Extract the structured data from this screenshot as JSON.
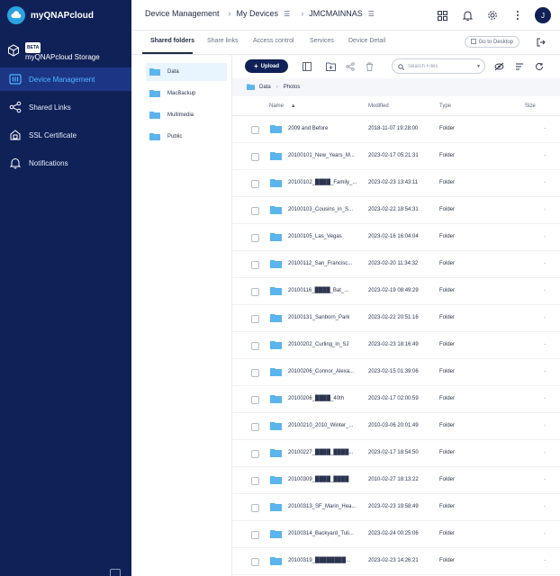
{
  "brand": {
    "name": "myQNAPcloud"
  },
  "sidebar": {
    "storage_badge": "BETA",
    "storage_label": "myQNAPcloud Storage",
    "items": [
      {
        "label": "Device Management",
        "icon": "device-management-icon"
      },
      {
        "label": "Shared Links",
        "icon": "share-icon"
      },
      {
        "label": "SSL Certificate",
        "icon": "ssl-certificate-icon"
      },
      {
        "label": "Notifications",
        "icon": "bell-icon"
      }
    ]
  },
  "header": {
    "breadcrumb": [
      "Device Management",
      "My Devices",
      "JMCMAINNAS"
    ],
    "avatar_initial": "J"
  },
  "tabs": {
    "items": [
      "Shared folders",
      "Share links",
      "Access control",
      "Services",
      "Device Detail"
    ],
    "active": "Shared folders",
    "go_to_desktop": "Go to Desktop"
  },
  "tree": {
    "items": [
      "Data",
      "MacBackup",
      "Multimedia",
      "Public"
    ],
    "selected": "Data"
  },
  "toolbar": {
    "upload_label": "Upload",
    "search_placeholder": "Search Files"
  },
  "path": [
    "Data",
    "Photos"
  ],
  "columns": {
    "name": "Name",
    "modified": "Modified",
    "type": "Type",
    "size": "Size"
  },
  "files": [
    {
      "name": "2009 and Before",
      "modified": "2018-11-07 19:28:00",
      "type": "Folder",
      "size": "-"
    },
    {
      "name": "20100101_New_Years_M...",
      "modified": "2023-02-17 05:21:31",
      "type": "Folder",
      "size": "-"
    },
    {
      "name": "20100102_████_Family_...",
      "modified": "2023-02-23 13:43:11",
      "type": "Folder",
      "size": "-"
    },
    {
      "name": "20100103_Cousins_in_S...",
      "modified": "2023-02-22 18:54:31",
      "type": "Folder",
      "size": "-"
    },
    {
      "name": "20100105_Las_Vegas",
      "modified": "2023-02-16 16:04:04",
      "type": "Folder",
      "size": "-"
    },
    {
      "name": "20100112_San_Francisc...",
      "modified": "2023-02-20 11:34:32",
      "type": "Folder",
      "size": "-"
    },
    {
      "name": "20100116_████_Bat_...",
      "modified": "2023-02-19 08:49:29",
      "type": "Folder",
      "size": "-"
    },
    {
      "name": "20100131_Sanborn_Park",
      "modified": "2023-02-22 20:51:16",
      "type": "Folder",
      "size": "-"
    },
    {
      "name": "20100202_Curling_in_SJ",
      "modified": "2023-02-23 18:16:49",
      "type": "Folder",
      "size": "-"
    },
    {
      "name": "20100206_Connor_Alexa...",
      "modified": "2023-02-15 01:39:06",
      "type": "Folder",
      "size": "-"
    },
    {
      "name": "20100206_████_40th",
      "modified": "2023-02-17 02:00:59",
      "type": "Folder",
      "size": "-"
    },
    {
      "name": "20100210_2010_Winter_...",
      "modified": "2010-03-06 20:01:49",
      "type": "Folder",
      "size": "-"
    },
    {
      "name": "20100227_████_████...",
      "modified": "2023-02-17 18:54:50",
      "type": "Folder",
      "size": "-"
    },
    {
      "name": "20100309_████_████",
      "modified": "2010-02-27 18:13:22",
      "type": "Folder",
      "size": "-"
    },
    {
      "name": "20100313_SF_Marin_Hea...",
      "modified": "2023-02-23 19:58:49",
      "type": "Folder",
      "size": "-"
    },
    {
      "name": "20100314_Backyard_Tuli...",
      "modified": "2023-02-24 00:25:06",
      "type": "Folder",
      "size": "-"
    },
    {
      "name": "20100319_████████...",
      "modified": "2023-02-23 14:26:21",
      "type": "Folder",
      "size": "-"
    }
  ],
  "colors": {
    "sidebar_bg": "#0f2157",
    "accent": "#4fb8ff",
    "folder": "#5ab4ee"
  }
}
